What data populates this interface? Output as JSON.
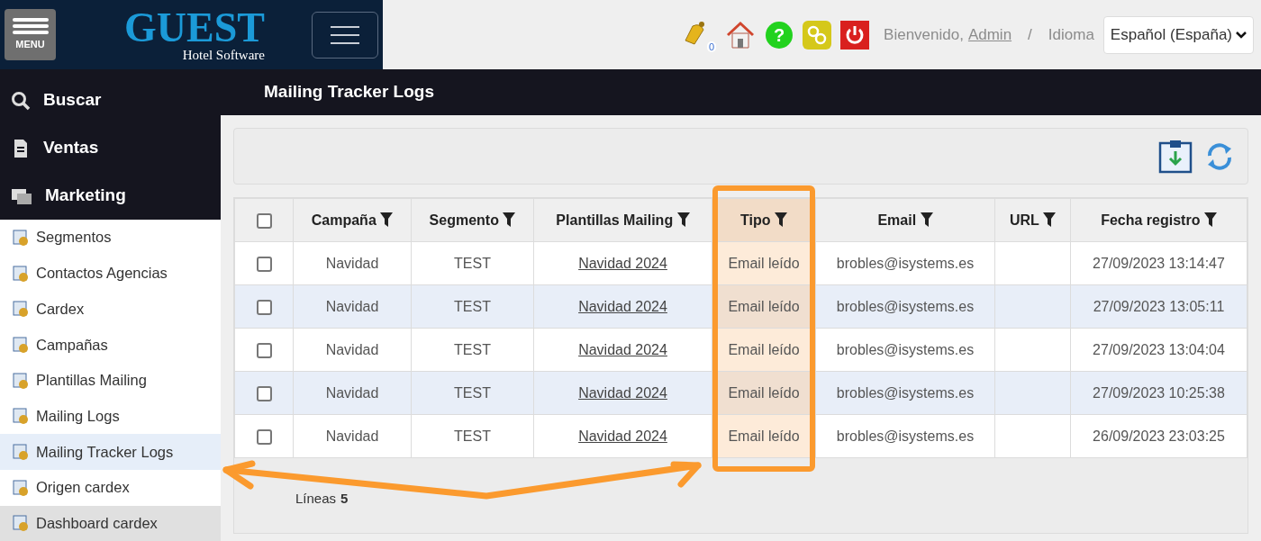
{
  "header": {
    "menu_button": "MENU",
    "logo_title": "GUEST",
    "logo_subtitle": "Hotel Software",
    "notifications_count": "0",
    "help_icon": "?",
    "welcome": "Bienvenido,",
    "user": "Admin",
    "separator": "/",
    "language_label": "Idioma",
    "language": "Español (España)"
  },
  "sidebar": {
    "sections": [
      {
        "label": "Buscar",
        "kind": "search"
      },
      {
        "label": "Ventas",
        "kind": "doc"
      },
      {
        "label": "Marketing",
        "kind": "group"
      }
    ],
    "items": [
      {
        "label": "Segmentos",
        "selected": false,
        "hovered": false
      },
      {
        "label": "Contactos Agencias",
        "selected": false,
        "hovered": false
      },
      {
        "label": "Cardex",
        "selected": false,
        "hovered": false
      },
      {
        "label": "Campañas",
        "selected": false,
        "hovered": false
      },
      {
        "label": "Plantillas Mailing",
        "selected": false,
        "hovered": false
      },
      {
        "label": "Mailing Logs",
        "selected": false,
        "hovered": false
      },
      {
        "label": "Mailing Tracker Logs",
        "selected": true,
        "hovered": false
      },
      {
        "label": "Origen cardex",
        "selected": false,
        "hovered": false
      },
      {
        "label": "Dashboard cardex",
        "selected": false,
        "hovered": true
      }
    ]
  },
  "page_title": "Mailing Tracker Logs",
  "table": {
    "select_all_checked": false,
    "columns": [
      {
        "label": "Campaña",
        "highlighted": false
      },
      {
        "label": "Segmento",
        "highlighted": false
      },
      {
        "label": "Plantillas Mailing",
        "highlighted": false
      },
      {
        "label": "Tipo",
        "highlighted": true
      },
      {
        "label": "Email",
        "highlighted": false
      },
      {
        "label": "URL",
        "highlighted": false
      },
      {
        "label": "Fecha registro",
        "highlighted": false
      }
    ],
    "rows": [
      {
        "checked": false,
        "cells": [
          "Navidad",
          "TEST",
          "Navidad 2024",
          "Email leído",
          "brobles@isystems.es",
          "",
          "27/09/2023 13:14:47"
        ]
      },
      {
        "checked": false,
        "cells": [
          "Navidad",
          "TEST",
          "Navidad 2024",
          "Email leído",
          "brobles@isystems.es",
          "",
          "27/09/2023 13:05:11"
        ]
      },
      {
        "checked": false,
        "cells": [
          "Navidad",
          "TEST",
          "Navidad 2024",
          "Email leído",
          "brobles@isystems.es",
          "",
          "27/09/2023 13:04:04"
        ]
      },
      {
        "checked": false,
        "cells": [
          "Navidad",
          "TEST",
          "Navidad 2024",
          "Email leído",
          "brobles@isystems.es",
          "",
          "27/09/2023 10:25:38"
        ]
      },
      {
        "checked": false,
        "cells": [
          "Navidad",
          "TEST",
          "Navidad 2024",
          "Email leído",
          "brobles@isystems.es",
          "",
          "26/09/2023 23:03:25"
        ]
      }
    ]
  },
  "footer": {
    "lines_label": "Líneas",
    "lines_count": "5"
  }
}
